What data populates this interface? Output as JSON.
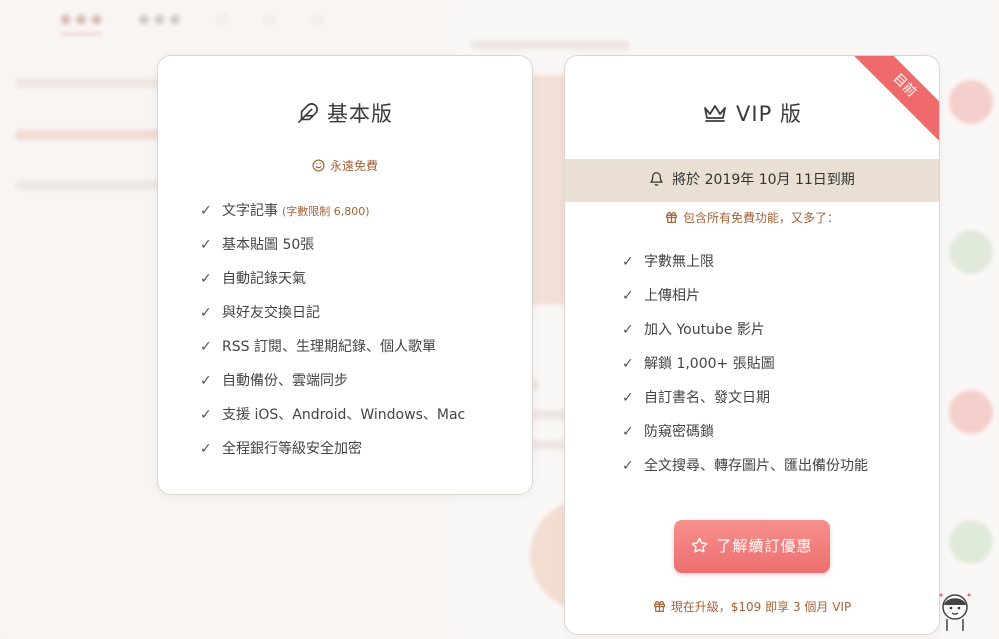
{
  "basic": {
    "title": "基本版",
    "subtitle": "永遠免費",
    "features": [
      {
        "text": "文字記事",
        "note": "(字數限制 6,800)"
      },
      {
        "text": "基本貼圖 50張"
      },
      {
        "text": "自動記錄天氣"
      },
      {
        "text": "與好友交換日記"
      },
      {
        "text": "RSS 訂閱、生理期紀錄、個人歌單"
      },
      {
        "text": "自動備份、雲端同步"
      },
      {
        "text": "支援 iOS、Android、Windows、Mac"
      },
      {
        "text": "全程銀行等級安全加密"
      }
    ]
  },
  "vip": {
    "title": "VIP 版",
    "ribbon": "目前",
    "expire_text": "將於 2019年 10月 11日到期",
    "subtitle": "包含所有免費功能，又多了：",
    "features": [
      "字數無上限",
      "上傳相片",
      "加入 Youtube 影片",
      "解鎖 1,000+ 張貼圖",
      "自訂書名、發文日期",
      "防窺密碼鎖",
      "全文搜尋、轉存圖片、匯出備份功能"
    ],
    "cta_label": "了解續訂優惠",
    "promo": "現在升級，$109 即享 3 個月 VIP"
  },
  "colors": {
    "accent": "#ed6f70",
    "brown_text": "#a4643a",
    "expire_bg": "#e9dfd2"
  },
  "icons": {
    "basic_title": "feather-icon",
    "basic_sub": "smile-icon",
    "vip_title": "crown-icon",
    "expire": "bell-icon",
    "vip_sub": "gift-icon",
    "cta": "star-icon",
    "promo": "gift-icon",
    "feature": "check-icon"
  }
}
